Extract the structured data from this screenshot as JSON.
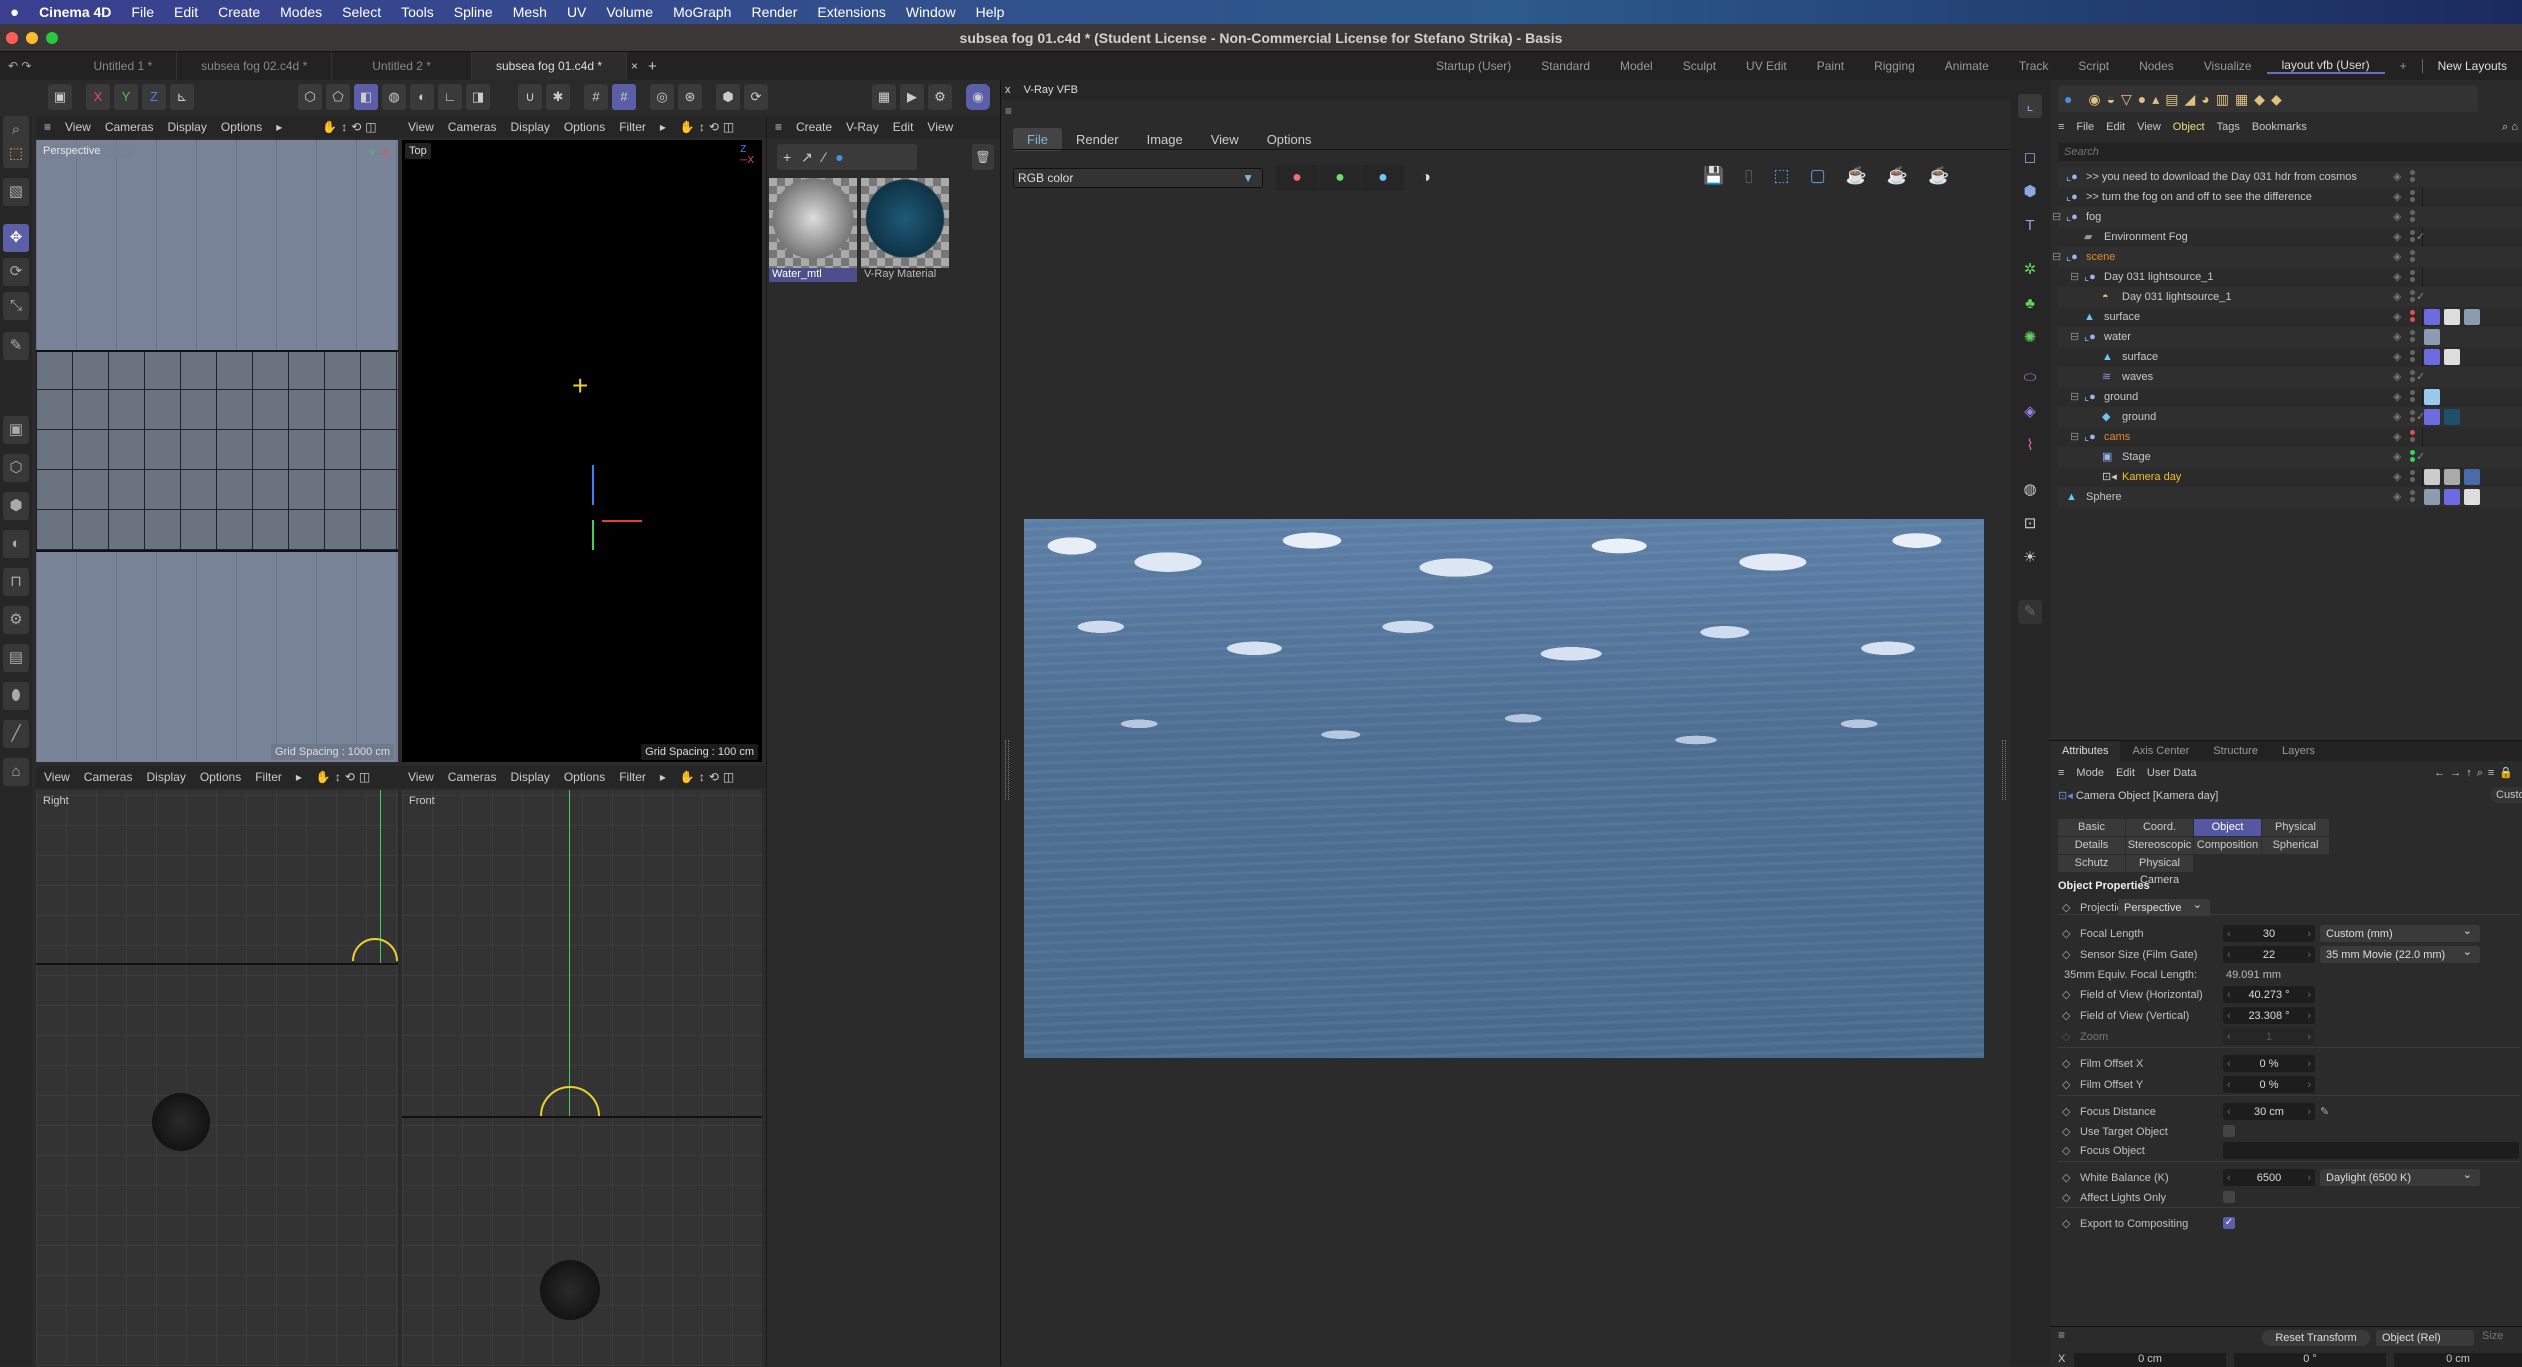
{
  "os_menu": {
    "apple_icon": "apple-logo",
    "items": [
      "Cinema 4D",
      "File",
      "Edit",
      "Create",
      "Modes",
      "Select",
      "Tools",
      "Spline",
      "Mesh",
      "UV",
      "Volume",
      "MoGraph",
      "Render",
      "Extensions",
      "Window",
      "Help"
    ]
  },
  "window": {
    "title": "subsea fog 01.c4d * (Student License - Non-Commercial License for Stefano Strika) - Basis"
  },
  "doc_tabs": [
    "Untitled 1 *",
    "subsea fog 02.c4d *",
    "Untitled 2 *",
    "subsea fog 01.c4d *"
  ],
  "active_doc": 3,
  "layouts": {
    "items": [
      "Startup (User)",
      "Standard",
      "Model",
      "Sculpt",
      "UV Edit",
      "Paint",
      "Rigging",
      "Animate",
      "Track",
      "Script",
      "Nodes",
      "Visualize",
      "layout vfb (User)"
    ],
    "active": 12,
    "add": "+",
    "new_layouts": "New Layouts"
  },
  "axis_toolbar": {
    "x": "X",
    "y": "Y",
    "z": "Z"
  },
  "viewport_menu": {
    "view": "View",
    "cameras": "Cameras",
    "display": "Display",
    "options": "Options",
    "filter": "Filter",
    "more": "▸"
  },
  "viewports": {
    "perspective": {
      "label": "Perspective",
      "grid": "Grid Spacing : 1000 cm"
    },
    "top": {
      "label": "Top",
      "grid": "Grid Spacing : 100 cm"
    },
    "right": {
      "label": "Right"
    },
    "front": {
      "label": "Front"
    }
  },
  "material_manager": {
    "menu": [
      "Create",
      "V-Ray",
      "Edit",
      "View"
    ],
    "materials": [
      {
        "name": "Water_mtl",
        "selected": true
      },
      {
        "name": "V-Ray Material",
        "selected": false
      }
    ]
  },
  "vfb": {
    "title": "V-Ray VFB",
    "close": "x",
    "menu": [
      "File",
      "Render",
      "Image",
      "View",
      "Options"
    ],
    "active_menu": 0,
    "channel": "RGB color",
    "channel_colors": [
      "#f07070",
      "#70d870",
      "#70c8f8"
    ]
  },
  "object_manager": {
    "menu": [
      "File",
      "Edit",
      "View",
      "Object",
      "Tags",
      "Bookmarks"
    ],
    "active_menu": 3,
    "search_placeholder": "Search",
    "objects": [
      {
        "name": ">> you need to download the Day 031 hdr from cosmos",
        "depth": 0,
        "icon": "null",
        "color": "#c8c8c8",
        "dots": [
          "#666",
          "#666"
        ],
        "expand": ""
      },
      {
        "name": ">> turn the fog on and off to see the difference",
        "depth": 0,
        "icon": "null",
        "color": "#c8c8c8",
        "dots": [
          "#666",
          "#666"
        ],
        "expand": ""
      },
      {
        "name": "fog",
        "depth": 0,
        "icon": "null",
        "color": "#c8c8c8",
        "dots": [
          "#666",
          "#666"
        ],
        "expand": "⊟"
      },
      {
        "name": "Environment Fog",
        "depth": 1,
        "icon": "fog",
        "color": "#c8c8c8",
        "dots": [
          "#666",
          "#666"
        ],
        "check": true,
        "expand": ""
      },
      {
        "name": "scene",
        "depth": 0,
        "icon": "null",
        "color": "#e08a2a",
        "dots": [
          "#666",
          "#666"
        ],
        "expand": "⊟"
      },
      {
        "name": "Day 031 lightsource_1",
        "depth": 1,
        "icon": "null",
        "color": "#c8c8c8",
        "dots": [
          "#666",
          "#666"
        ],
        "expand": "⊟"
      },
      {
        "name": "Day 031 lightsource_1",
        "depth": 2,
        "icon": "light",
        "color": "#c8c8c8",
        "dots": [
          "#666",
          "#666"
        ],
        "check": true,
        "expand": ""
      },
      {
        "name": "surface",
        "depth": 1,
        "icon": "poly",
        "color": "#c8c8c8",
        "dots": [
          "#e05050",
          "#e05050"
        ],
        "tags": [
          "#6c6ce0",
          "#ddd",
          "#8b9bb0"
        ],
        "expand": ""
      },
      {
        "name": "water",
        "depth": 1,
        "icon": "null",
        "color": "#c8c8c8",
        "dots": [
          "#666",
          "#666"
        ],
        "tags": [
          "#8b9bb0"
        ],
        "expand": "⊟"
      },
      {
        "name": "surface",
        "depth": 2,
        "icon": "poly",
        "color": "#c8c8c8",
        "dots": [
          "#666",
          "#666"
        ],
        "tags": [
          "#6c6ce0",
          "#ddd"
        ],
        "expand": ""
      },
      {
        "name": "waves",
        "depth": 2,
        "icon": "waves",
        "color": "#c8c8c8",
        "dots": [
          "#666",
          "#666"
        ],
        "check": true,
        "expand": ""
      },
      {
        "name": "ground",
        "depth": 1,
        "icon": "null",
        "color": "#c8c8c8",
        "dots": [
          "#666",
          "#666"
        ],
        "tags": [
          "#9ac8e8"
        ],
        "expand": "⊟"
      },
      {
        "name": "ground",
        "depth": 2,
        "icon": "plane",
        "color": "#c8c8c8",
        "dots": [
          "#666",
          "#666"
        ],
        "check": true,
        "tags": [
          "#6c6ce0",
          "#1e4f6b"
        ],
        "expand": ""
      },
      {
        "name": "cams",
        "depth": 1,
        "icon": "null",
        "color": "#e08a2a",
        "dots": [
          "#e05050",
          "#666"
        ],
        "expand": "⊟"
      },
      {
        "name": "Stage",
        "depth": 2,
        "icon": "stage",
        "color": "#c8c8c8",
        "dots": [
          "#40d060",
          "#40d060"
        ],
        "check": true,
        "expand": ""
      },
      {
        "name": "Kamera day",
        "depth": 2,
        "icon": "camera",
        "color": "#f0c020",
        "dots": [
          "#666",
          "#666"
        ],
        "tags": [
          "#ccc",
          "#aaa",
          "#4a6aa8"
        ],
        "expand": ""
      },
      {
        "name": "Sphere",
        "depth": 0,
        "icon": "poly",
        "color": "#c8c8c8",
        "dots": [
          "#666",
          "#666"
        ],
        "tags": [
          "#8b9bb0",
          "#6c6ce0",
          "#ddd"
        ],
        "expand": ""
      }
    ]
  },
  "attributes": {
    "tabs": [
      "Attributes",
      "Axis Center",
      "Structure",
      "Layers"
    ],
    "active_tab": 0,
    "menu": [
      "Mode",
      "Edit",
      "User Data"
    ],
    "object_title": "Camera Object [Kamera day]",
    "preset": "Custom",
    "prop_tabs": [
      "Basic",
      "Coord.",
      "Object",
      "Physical",
      "Details",
      "Stereoscopic",
      "Composition",
      "Spherical",
      "Schutz",
      "Physical Camera"
    ],
    "active_prop_tab": 2,
    "section": "Object Properties",
    "projection": {
      "label": "Projection",
      "value": "Perspective"
    },
    "focal_length": {
      "label": "Focal Length",
      "value": "30",
      "preset": "Custom (mm)"
    },
    "sensor_size": {
      "label": "Sensor Size (Film Gate)",
      "value": "22",
      "preset": "35 mm Movie (22.0 mm)"
    },
    "equiv_focal": {
      "label": "35mm Equiv. Focal Length:",
      "value": "49.091 mm"
    },
    "fov_h": {
      "label": "Field of View (Horizontal)",
      "value": "40.273 °"
    },
    "fov_v": {
      "label": "Field of View (Vertical)",
      "value": "23.308 °"
    },
    "zoom": {
      "label": "Zoom",
      "value": "1"
    },
    "film_offset_x": {
      "label": "Film Offset X",
      "value": "0 %"
    },
    "film_offset_y": {
      "label": "Film Offset Y",
      "value": "0 %"
    },
    "focus_distance": {
      "label": "Focus Distance",
      "value": "30 cm"
    },
    "use_target": {
      "label": "Use Target Object",
      "checked": false
    },
    "focus_object": {
      "label": "Focus Object",
      "value": ""
    },
    "white_balance": {
      "label": "White Balance (K)",
      "value": "6500",
      "preset": "Daylight (6500 K)"
    },
    "affect_lights": {
      "label": "Affect Lights Only",
      "checked": false
    },
    "export_comp": {
      "label": "Export to Compositing",
      "checked": true
    }
  },
  "coords": {
    "reset": "Reset Transform",
    "mode": "Object (Rel)",
    "size": "Size",
    "x_label": "X",
    "x_pos": "0 cm",
    "x_rot": "0 °",
    "x_size": "0 cm"
  }
}
